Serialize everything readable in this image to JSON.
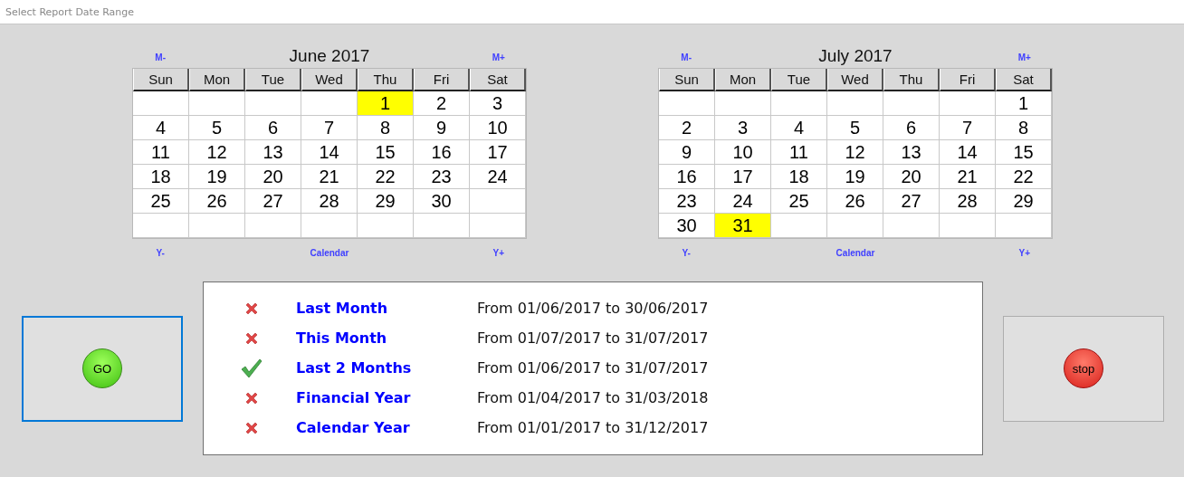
{
  "window": {
    "title": "Select Report Date Range"
  },
  "calendars": [
    {
      "title": "June 2017",
      "month_prev": "M-",
      "month_next": "M+",
      "year_prev": "Y-",
      "year_next": "Y+",
      "footer": "Calendar",
      "weekdays": [
        "Sun",
        "Mon",
        "Tue",
        "Wed",
        "Thu",
        "Fri",
        "Sat"
      ],
      "weeks": [
        [
          {
            "kind": "blank"
          },
          {
            "kind": "blank"
          },
          {
            "kind": "blank"
          },
          {
            "kind": "blank"
          },
          {
            "kind": "day",
            "day": "1",
            "selected": true
          },
          {
            "kind": "day",
            "day": "2",
            "selected": false
          },
          {
            "kind": "day",
            "day": "3",
            "selected": false
          }
        ],
        [
          {
            "kind": "day",
            "day": "4",
            "selected": false
          },
          {
            "kind": "day",
            "day": "5",
            "selected": false
          },
          {
            "kind": "day",
            "day": "6",
            "selected": false
          },
          {
            "kind": "day",
            "day": "7",
            "selected": false
          },
          {
            "kind": "day",
            "day": "8",
            "selected": false
          },
          {
            "kind": "day",
            "day": "9",
            "selected": false
          },
          {
            "kind": "day",
            "day": "10",
            "selected": false
          }
        ],
        [
          {
            "kind": "day",
            "day": "11",
            "selected": false
          },
          {
            "kind": "day",
            "day": "12",
            "selected": false
          },
          {
            "kind": "day",
            "day": "13",
            "selected": false
          },
          {
            "kind": "day",
            "day": "14",
            "selected": false
          },
          {
            "kind": "day",
            "day": "15",
            "selected": false
          },
          {
            "kind": "day",
            "day": "16",
            "selected": false
          },
          {
            "kind": "day",
            "day": "17",
            "selected": false
          }
        ],
        [
          {
            "kind": "day",
            "day": "18",
            "selected": false
          },
          {
            "kind": "day",
            "day": "19",
            "selected": false
          },
          {
            "kind": "day",
            "day": "20",
            "selected": false
          },
          {
            "kind": "day",
            "day": "21",
            "selected": false
          },
          {
            "kind": "day",
            "day": "22",
            "selected": false
          },
          {
            "kind": "day",
            "day": "23",
            "selected": false
          },
          {
            "kind": "day",
            "day": "24",
            "selected": false
          }
        ],
        [
          {
            "kind": "day",
            "day": "25",
            "selected": false
          },
          {
            "kind": "day",
            "day": "26",
            "selected": false
          },
          {
            "kind": "day",
            "day": "27",
            "selected": false
          },
          {
            "kind": "day",
            "day": "28",
            "selected": false
          },
          {
            "kind": "day",
            "day": "29",
            "selected": false
          },
          {
            "kind": "day",
            "day": "30",
            "selected": false
          },
          {
            "kind": "blank"
          }
        ],
        [
          {
            "kind": "blank"
          },
          {
            "kind": "blank"
          },
          {
            "kind": "blank"
          },
          {
            "kind": "blank"
          },
          {
            "kind": "blank"
          },
          {
            "kind": "blank"
          },
          {
            "kind": "blank"
          }
        ]
      ]
    },
    {
      "title": "July 2017",
      "month_prev": "M-",
      "month_next": "M+",
      "year_prev": "Y-",
      "year_next": "Y+",
      "footer": "Calendar",
      "weekdays": [
        "Sun",
        "Mon",
        "Tue",
        "Wed",
        "Thu",
        "Fri",
        "Sat"
      ],
      "weeks": [
        [
          {
            "kind": "blank"
          },
          {
            "kind": "blank"
          },
          {
            "kind": "blank"
          },
          {
            "kind": "blank"
          },
          {
            "kind": "blank"
          },
          {
            "kind": "blank"
          },
          {
            "kind": "day",
            "day": "1",
            "selected": false
          }
        ],
        [
          {
            "kind": "day",
            "day": "2",
            "selected": false
          },
          {
            "kind": "day",
            "day": "3",
            "selected": false
          },
          {
            "kind": "day",
            "day": "4",
            "selected": false
          },
          {
            "kind": "day",
            "day": "5",
            "selected": false
          },
          {
            "kind": "day",
            "day": "6",
            "selected": false
          },
          {
            "kind": "day",
            "day": "7",
            "selected": false
          },
          {
            "kind": "day",
            "day": "8",
            "selected": false
          }
        ],
        [
          {
            "kind": "day",
            "day": "9",
            "selected": false
          },
          {
            "kind": "day",
            "day": "10",
            "selected": false
          },
          {
            "kind": "day",
            "day": "11",
            "selected": false
          },
          {
            "kind": "day",
            "day": "12",
            "selected": false
          },
          {
            "kind": "day",
            "day": "13",
            "selected": false
          },
          {
            "kind": "day",
            "day": "14",
            "selected": false
          },
          {
            "kind": "day",
            "day": "15",
            "selected": false
          }
        ],
        [
          {
            "kind": "day",
            "day": "16",
            "selected": false
          },
          {
            "kind": "day",
            "day": "17",
            "selected": false
          },
          {
            "kind": "day",
            "day": "18",
            "selected": false
          },
          {
            "kind": "day",
            "day": "19",
            "selected": false
          },
          {
            "kind": "day",
            "day": "20",
            "selected": false
          },
          {
            "kind": "day",
            "day": "21",
            "selected": false
          },
          {
            "kind": "day",
            "day": "22",
            "selected": false
          }
        ],
        [
          {
            "kind": "day",
            "day": "23",
            "selected": false
          },
          {
            "kind": "day",
            "day": "24",
            "selected": false
          },
          {
            "kind": "day",
            "day": "25",
            "selected": false
          },
          {
            "kind": "day",
            "day": "26",
            "selected": false
          },
          {
            "kind": "day",
            "day": "27",
            "selected": false
          },
          {
            "kind": "day",
            "day": "28",
            "selected": false
          },
          {
            "kind": "day",
            "day": "29",
            "selected": false
          }
        ],
        [
          {
            "kind": "day",
            "day": "30",
            "selected": false
          },
          {
            "kind": "day",
            "day": "31",
            "selected": true
          },
          {
            "kind": "blank"
          },
          {
            "kind": "blank"
          },
          {
            "kind": "blank"
          },
          {
            "kind": "blank"
          },
          {
            "kind": "blank"
          }
        ]
      ]
    }
  ],
  "go_button": {
    "label": "GO",
    "focused": true
  },
  "ranges": [
    {
      "label": "Last Month",
      "range": "From 01/06/2017 to 30/06/2017",
      "checked": false
    },
    {
      "label": "This Month",
      "range": "From 01/07/2017 to 31/07/2017",
      "checked": false
    },
    {
      "label": "Last 2 Months",
      "range": "From 01/06/2017 to 31/07/2017",
      "checked": true
    },
    {
      "label": "Financial Year",
      "range": "From 01/04/2017 to 31/03/2018",
      "checked": false
    },
    {
      "label": "Calendar Year",
      "range": "From 01/01/2017 to 31/12/2017",
      "checked": false
    }
  ],
  "stop_button": {
    "label": "stop",
    "focused": false
  }
}
